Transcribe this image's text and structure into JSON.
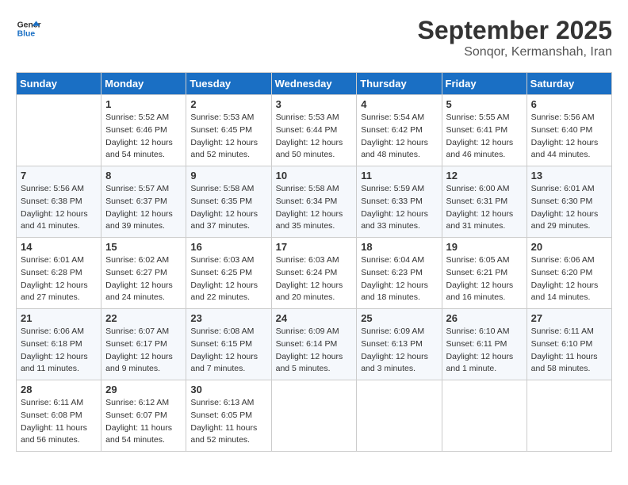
{
  "app": {
    "logo_line1": "General",
    "logo_line2": "Blue"
  },
  "header": {
    "month_year": "September 2025",
    "location": "Sonqor, Kermanshah, Iran"
  },
  "days_of_week": [
    "Sunday",
    "Monday",
    "Tuesday",
    "Wednesday",
    "Thursday",
    "Friday",
    "Saturday"
  ],
  "weeks": [
    [
      {
        "num": "",
        "sunrise": "",
        "sunset": "",
        "daylight": ""
      },
      {
        "num": "1",
        "sunrise": "Sunrise: 5:52 AM",
        "sunset": "Sunset: 6:46 PM",
        "daylight": "Daylight: 12 hours and 54 minutes."
      },
      {
        "num": "2",
        "sunrise": "Sunrise: 5:53 AM",
        "sunset": "Sunset: 6:45 PM",
        "daylight": "Daylight: 12 hours and 52 minutes."
      },
      {
        "num": "3",
        "sunrise": "Sunrise: 5:53 AM",
        "sunset": "Sunset: 6:44 PM",
        "daylight": "Daylight: 12 hours and 50 minutes."
      },
      {
        "num": "4",
        "sunrise": "Sunrise: 5:54 AM",
        "sunset": "Sunset: 6:42 PM",
        "daylight": "Daylight: 12 hours and 48 minutes."
      },
      {
        "num": "5",
        "sunrise": "Sunrise: 5:55 AM",
        "sunset": "Sunset: 6:41 PM",
        "daylight": "Daylight: 12 hours and 46 minutes."
      },
      {
        "num": "6",
        "sunrise": "Sunrise: 5:56 AM",
        "sunset": "Sunset: 6:40 PM",
        "daylight": "Daylight: 12 hours and 44 minutes."
      }
    ],
    [
      {
        "num": "7",
        "sunrise": "Sunrise: 5:56 AM",
        "sunset": "Sunset: 6:38 PM",
        "daylight": "Daylight: 12 hours and 41 minutes."
      },
      {
        "num": "8",
        "sunrise": "Sunrise: 5:57 AM",
        "sunset": "Sunset: 6:37 PM",
        "daylight": "Daylight: 12 hours and 39 minutes."
      },
      {
        "num": "9",
        "sunrise": "Sunrise: 5:58 AM",
        "sunset": "Sunset: 6:35 PM",
        "daylight": "Daylight: 12 hours and 37 minutes."
      },
      {
        "num": "10",
        "sunrise": "Sunrise: 5:58 AM",
        "sunset": "Sunset: 6:34 PM",
        "daylight": "Daylight: 12 hours and 35 minutes."
      },
      {
        "num": "11",
        "sunrise": "Sunrise: 5:59 AM",
        "sunset": "Sunset: 6:33 PM",
        "daylight": "Daylight: 12 hours and 33 minutes."
      },
      {
        "num": "12",
        "sunrise": "Sunrise: 6:00 AM",
        "sunset": "Sunset: 6:31 PM",
        "daylight": "Daylight: 12 hours and 31 minutes."
      },
      {
        "num": "13",
        "sunrise": "Sunrise: 6:01 AM",
        "sunset": "Sunset: 6:30 PM",
        "daylight": "Daylight: 12 hours and 29 minutes."
      }
    ],
    [
      {
        "num": "14",
        "sunrise": "Sunrise: 6:01 AM",
        "sunset": "Sunset: 6:28 PM",
        "daylight": "Daylight: 12 hours and 27 minutes."
      },
      {
        "num": "15",
        "sunrise": "Sunrise: 6:02 AM",
        "sunset": "Sunset: 6:27 PM",
        "daylight": "Daylight: 12 hours and 24 minutes."
      },
      {
        "num": "16",
        "sunrise": "Sunrise: 6:03 AM",
        "sunset": "Sunset: 6:25 PM",
        "daylight": "Daylight: 12 hours and 22 minutes."
      },
      {
        "num": "17",
        "sunrise": "Sunrise: 6:03 AM",
        "sunset": "Sunset: 6:24 PM",
        "daylight": "Daylight: 12 hours and 20 minutes."
      },
      {
        "num": "18",
        "sunrise": "Sunrise: 6:04 AM",
        "sunset": "Sunset: 6:23 PM",
        "daylight": "Daylight: 12 hours and 18 minutes."
      },
      {
        "num": "19",
        "sunrise": "Sunrise: 6:05 AM",
        "sunset": "Sunset: 6:21 PM",
        "daylight": "Daylight: 12 hours and 16 minutes."
      },
      {
        "num": "20",
        "sunrise": "Sunrise: 6:06 AM",
        "sunset": "Sunset: 6:20 PM",
        "daylight": "Daylight: 12 hours and 14 minutes."
      }
    ],
    [
      {
        "num": "21",
        "sunrise": "Sunrise: 6:06 AM",
        "sunset": "Sunset: 6:18 PM",
        "daylight": "Daylight: 12 hours and 11 minutes."
      },
      {
        "num": "22",
        "sunrise": "Sunrise: 6:07 AM",
        "sunset": "Sunset: 6:17 PM",
        "daylight": "Daylight: 12 hours and 9 minutes."
      },
      {
        "num": "23",
        "sunrise": "Sunrise: 6:08 AM",
        "sunset": "Sunset: 6:15 PM",
        "daylight": "Daylight: 12 hours and 7 minutes."
      },
      {
        "num": "24",
        "sunrise": "Sunrise: 6:09 AM",
        "sunset": "Sunset: 6:14 PM",
        "daylight": "Daylight: 12 hours and 5 minutes."
      },
      {
        "num": "25",
        "sunrise": "Sunrise: 6:09 AM",
        "sunset": "Sunset: 6:13 PM",
        "daylight": "Daylight: 12 hours and 3 minutes."
      },
      {
        "num": "26",
        "sunrise": "Sunrise: 6:10 AM",
        "sunset": "Sunset: 6:11 PM",
        "daylight": "Daylight: 12 hours and 1 minute."
      },
      {
        "num": "27",
        "sunrise": "Sunrise: 6:11 AM",
        "sunset": "Sunset: 6:10 PM",
        "daylight": "Daylight: 11 hours and 58 minutes."
      }
    ],
    [
      {
        "num": "28",
        "sunrise": "Sunrise: 6:11 AM",
        "sunset": "Sunset: 6:08 PM",
        "daylight": "Daylight: 11 hours and 56 minutes."
      },
      {
        "num": "29",
        "sunrise": "Sunrise: 6:12 AM",
        "sunset": "Sunset: 6:07 PM",
        "daylight": "Daylight: 11 hours and 54 minutes."
      },
      {
        "num": "30",
        "sunrise": "Sunrise: 6:13 AM",
        "sunset": "Sunset: 6:05 PM",
        "daylight": "Daylight: 11 hours and 52 minutes."
      },
      {
        "num": "",
        "sunrise": "",
        "sunset": "",
        "daylight": ""
      },
      {
        "num": "",
        "sunrise": "",
        "sunset": "",
        "daylight": ""
      },
      {
        "num": "",
        "sunrise": "",
        "sunset": "",
        "daylight": ""
      },
      {
        "num": "",
        "sunrise": "",
        "sunset": "",
        "daylight": ""
      }
    ]
  ]
}
